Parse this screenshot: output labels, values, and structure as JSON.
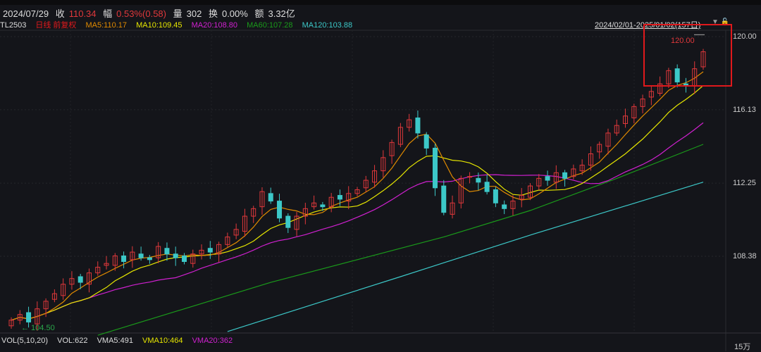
{
  "header": {
    "date": "2024/07/29",
    "close_label": "收",
    "close": "110.34",
    "change_label": "幅",
    "change": "0.53%(0.58)",
    "volume_label": "量",
    "volume": "302",
    "turnover_label": "换",
    "turnover": "0.00%",
    "amount_label": "额",
    "amount": "3.32亿"
  },
  "legend": {
    "symbol": "TL2503",
    "period": "日线 前复权",
    "ma5": "MA5:110.17",
    "ma10": "MA10:109.45",
    "ma20": "MA20:108.80",
    "ma60": "MA60:107.28",
    "ma120": "MA120:103.88"
  },
  "range": "2024/02/01-2025/01/02(157日)",
  "volume_legend": {
    "title": "VOL(5,10,20)",
    "vol": "VOL:622",
    "vma5": "VMA5:491",
    "vma10": "VMA10:464",
    "vma20": "VMA20:362"
  },
  "volume_unit": "15万",
  "colors": {
    "up": "#e0383b",
    "down": "#3cc8c8",
    "ma5": "#e08a00",
    "ma10": "#e6e600",
    "ma20": "#d020d0",
    "ma60": "#1a9a1a",
    "ma120": "#3cc8c8"
  },
  "chart_data": {
    "type": "candlestick",
    "yticks": [
      "120.00",
      "116.13",
      "112.25",
      "108.38"
    ],
    "ylim": [
      104.4,
      120.5
    ],
    "high_marker": "120.00",
    "low_marker": "← 104.50",
    "closes": [
      105.0,
      105.3,
      104.9,
      105.6,
      106.0,
      106.4,
      106.9,
      107.2,
      107.0,
      107.5,
      107.8,
      108.0,
      108.4,
      108.1,
      108.6,
      108.3,
      108.2,
      108.9,
      108.5,
      108.3,
      108.1,
      108.5,
      108.7,
      108.6,
      109.0,
      109.4,
      109.8,
      110.5,
      110.9,
      111.8,
      111.3,
      110.4,
      109.9,
      110.5,
      110.9,
      111.2,
      111.0,
      111.5,
      111.4,
      111.7,
      111.9,
      112.4,
      112.9,
      113.6,
      114.4,
      115.2,
      115.6,
      114.9,
      114.1,
      112.0,
      110.7,
      111.2,
      112.5,
      112.6,
      112.3,
      111.8,
      111.2,
      110.9,
      111.3,
      111.6,
      112.1,
      112.5,
      112.4,
      112.8,
      112.5,
      113.0,
      113.2,
      113.8,
      114.3,
      114.9,
      115.3,
      115.8,
      116.3,
      116.7,
      117.1,
      117.5,
      118.2,
      117.6,
      117.4,
      118.3,
      119.2
    ],
    "ma60": [
      [
        10,
        104.2
      ],
      [
        30,
        107.0
      ],
      [
        50,
        109.4
      ],
      [
        60,
        110.8
      ],
      [
        70,
        112.5
      ],
      [
        80,
        114.3
      ]
    ],
    "ma120": [
      [
        25,
        104.4
      ],
      [
        45,
        107.3
      ],
      [
        60,
        109.5
      ],
      [
        80,
        112.3
      ]
    ]
  }
}
